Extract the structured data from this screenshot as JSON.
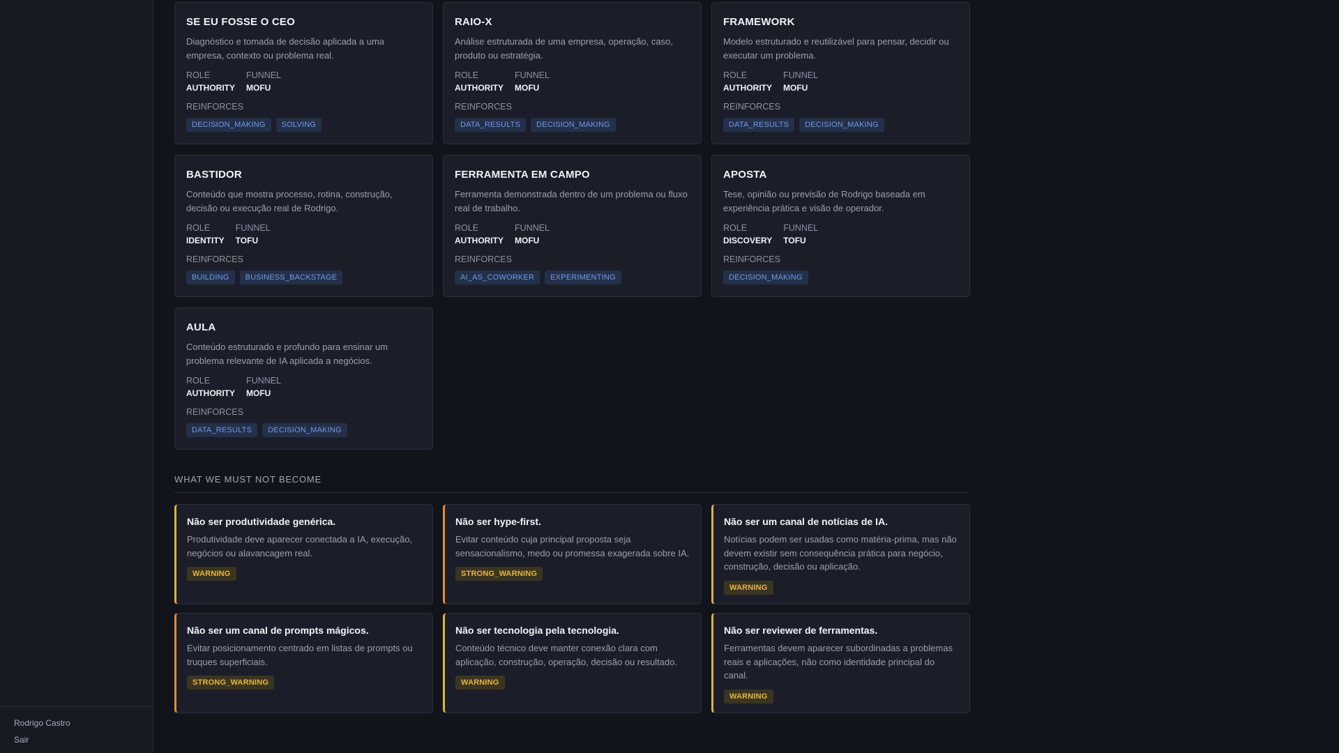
{
  "sidebar": {
    "user_name": "Rodrigo Castro",
    "logout_label": "Sair"
  },
  "formats": [
    {
      "title": "SE EU FOSSE O CEO",
      "description": "Diagnóstico e tomada de decisão aplicada a uma empresa, contexto ou problema real.",
      "role_label": "ROLE",
      "role": "AUTHORITY",
      "funnel_label": "FUNNEL",
      "funnel": "MOFU",
      "reinforces_label": "REINFORCES",
      "reinforces": [
        "DECISION_MAKING",
        "SOLVING"
      ]
    },
    {
      "title": "RAIO-X",
      "description": "Análise estruturada de uma empresa, operação, caso, produto ou estratégia.",
      "role_label": "ROLE",
      "role": "AUTHORITY",
      "funnel_label": "FUNNEL",
      "funnel": "MOFU",
      "reinforces_label": "REINFORCES",
      "reinforces": [
        "DATA_RESULTS",
        "DECISION_MAKING"
      ]
    },
    {
      "title": "FRAMEWORK",
      "description": "Modelo estruturado e reutilizável para pensar, decidir ou executar um problema.",
      "role_label": "ROLE",
      "role": "AUTHORITY",
      "funnel_label": "FUNNEL",
      "funnel": "MOFU",
      "reinforces_label": "REINFORCES",
      "reinforces": [
        "DATA_RESULTS",
        "DECISION_MAKING"
      ]
    },
    {
      "title": "BASTIDOR",
      "description": "Conteúdo que mostra processo, rotina, construção, decisão ou execução real de Rodrigo.",
      "role_label": "ROLE",
      "role": "IDENTITY",
      "funnel_label": "FUNNEL",
      "funnel": "TOFU",
      "reinforces_label": "REINFORCES",
      "reinforces": [
        "BUILDING",
        "BUSINESS_BACKSTAGE"
      ]
    },
    {
      "title": "FERRAMENTA EM CAMPO",
      "description": "Ferramenta demonstrada dentro de um problema ou fluxo real de trabalho.",
      "role_label": "ROLE",
      "role": "AUTHORITY",
      "funnel_label": "FUNNEL",
      "funnel": "MOFU",
      "reinforces_label": "REINFORCES",
      "reinforces": [
        "AI_AS_COWORKER",
        "EXPERIMENTING"
      ]
    },
    {
      "title": "APOSTA",
      "description": "Tese, opinião ou previsão de Rodrigo baseada em experiência prática e visão de operador.",
      "role_label": "ROLE",
      "role": "DISCOVERY",
      "funnel_label": "FUNNEL",
      "funnel": "TOFU",
      "reinforces_label": "REINFORCES",
      "reinforces": [
        "DECISION_MAKING"
      ]
    },
    {
      "title": "AULA",
      "description": "Conteúdo estruturado e profundo para ensinar um problema relevante de IA aplicada a negócios.",
      "role_label": "ROLE",
      "role": "AUTHORITY",
      "funnel_label": "FUNNEL",
      "funnel": "MOFU",
      "reinforces_label": "REINFORCES",
      "reinforces": [
        "DATA_RESULTS",
        "DECISION_MAKING"
      ]
    }
  ],
  "anti_section": {
    "heading": "WHAT WE MUST NOT BECOME",
    "items": [
      {
        "title": "Não ser produtividade genérica.",
        "description": "Produtividade deve aparecer conectada a IA, execução, negócios ou alavancagem real.",
        "level": "WARNING"
      },
      {
        "title": "Não ser hype-first.",
        "description": "Evitar conteúdo cuja principal proposta seja sensacionalismo, medo ou promessa exagerada sobre IA.",
        "level": "STRONG_WARNING"
      },
      {
        "title": "Não ser um canal de notícias de IA.",
        "description": "Notícias podem ser usadas como matéria-prima, mas não devem existir sem consequência prática para negócio, construção, decisão ou aplicação.",
        "level": "WARNING"
      },
      {
        "title": "Não ser um canal de prompts mágicos.",
        "description": "Evitar posicionamento centrado em listas de prompts ou truques superficiais.",
        "level": "STRONG_WARNING"
      },
      {
        "title": "Não ser tecnologia pela tecnologia.",
        "description": "Conteúdo técnico deve manter conexão clara com aplicação, construção, operação, decisão ou resultado.",
        "level": "WARNING"
      },
      {
        "title": "Não ser reviewer de ferramentas.",
        "description": "Ferramentas devem aparecer subordinadas a problemas reais e aplicações, não como identidade principal do canal.",
        "level": "WARNING"
      }
    ]
  },
  "colors": {
    "background": "#12141b",
    "card": "#1b1e29",
    "chip_text": "#6f9be6",
    "warning_accent": "#e0b23b",
    "strong_warning_accent": "#e58a3a"
  }
}
